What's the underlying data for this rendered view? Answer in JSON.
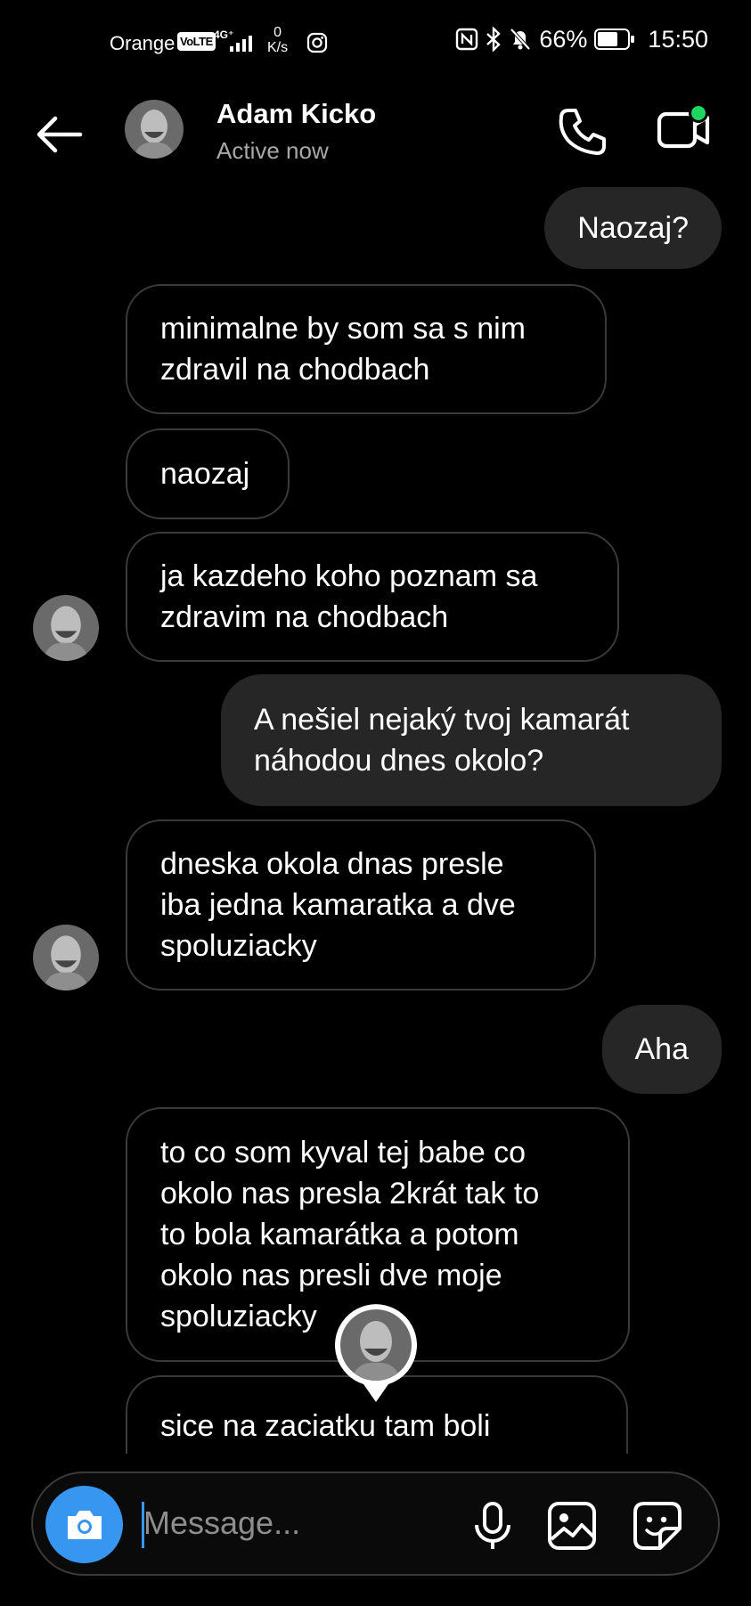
{
  "status_bar": {
    "carrier": "Orange",
    "volte": "VoLTE",
    "network": "4G⁺",
    "speed_value": "0",
    "speed_unit": "K/s",
    "battery": "66%",
    "time": "15:50"
  },
  "header": {
    "contact_name": "Adam Kicko",
    "contact_status": "Active now",
    "video_call_active_color": "#1ed760"
  },
  "messages": [
    {
      "sender": "me",
      "text": "Naozaj?"
    },
    {
      "sender": "them",
      "text": "minimalne by som sa s nim\nzdravil na chodbach"
    },
    {
      "sender": "them",
      "text": "naozaj"
    },
    {
      "sender": "them",
      "text": "ja kazdeho koho poznam sa\nzdravim na chodbach"
    },
    {
      "sender": "me",
      "text": "A nešiel nejaký tvoj kamarát\nnáhodou dnes okolo?"
    },
    {
      "sender": "them",
      "text": "dneska okola dnas presle\niba jedna kamaratka a dve\nspoluziacky"
    },
    {
      "sender": "me",
      "text": "Aha"
    },
    {
      "sender": "them",
      "text": "to co som kyval tej babe co\nokolo nas presla 2krát tak to\nto bola kamarátka a potom\nokolo nas presli dve moje\nspoluziacky"
    },
    {
      "sender": "them",
      "text": "sice na zaciatku tam boli"
    }
  ],
  "composer": {
    "placeholder": "Message..."
  },
  "colors": {
    "accent": "#3797f0",
    "outgoing_bubble": "#262626",
    "incoming_border": "#3a3a3a",
    "background": "#000000"
  },
  "icons": [
    "back-arrow-icon",
    "phone-icon",
    "video-camera-icon",
    "camera-icon",
    "microphone-icon",
    "gallery-icon",
    "sticker-icon"
  ]
}
